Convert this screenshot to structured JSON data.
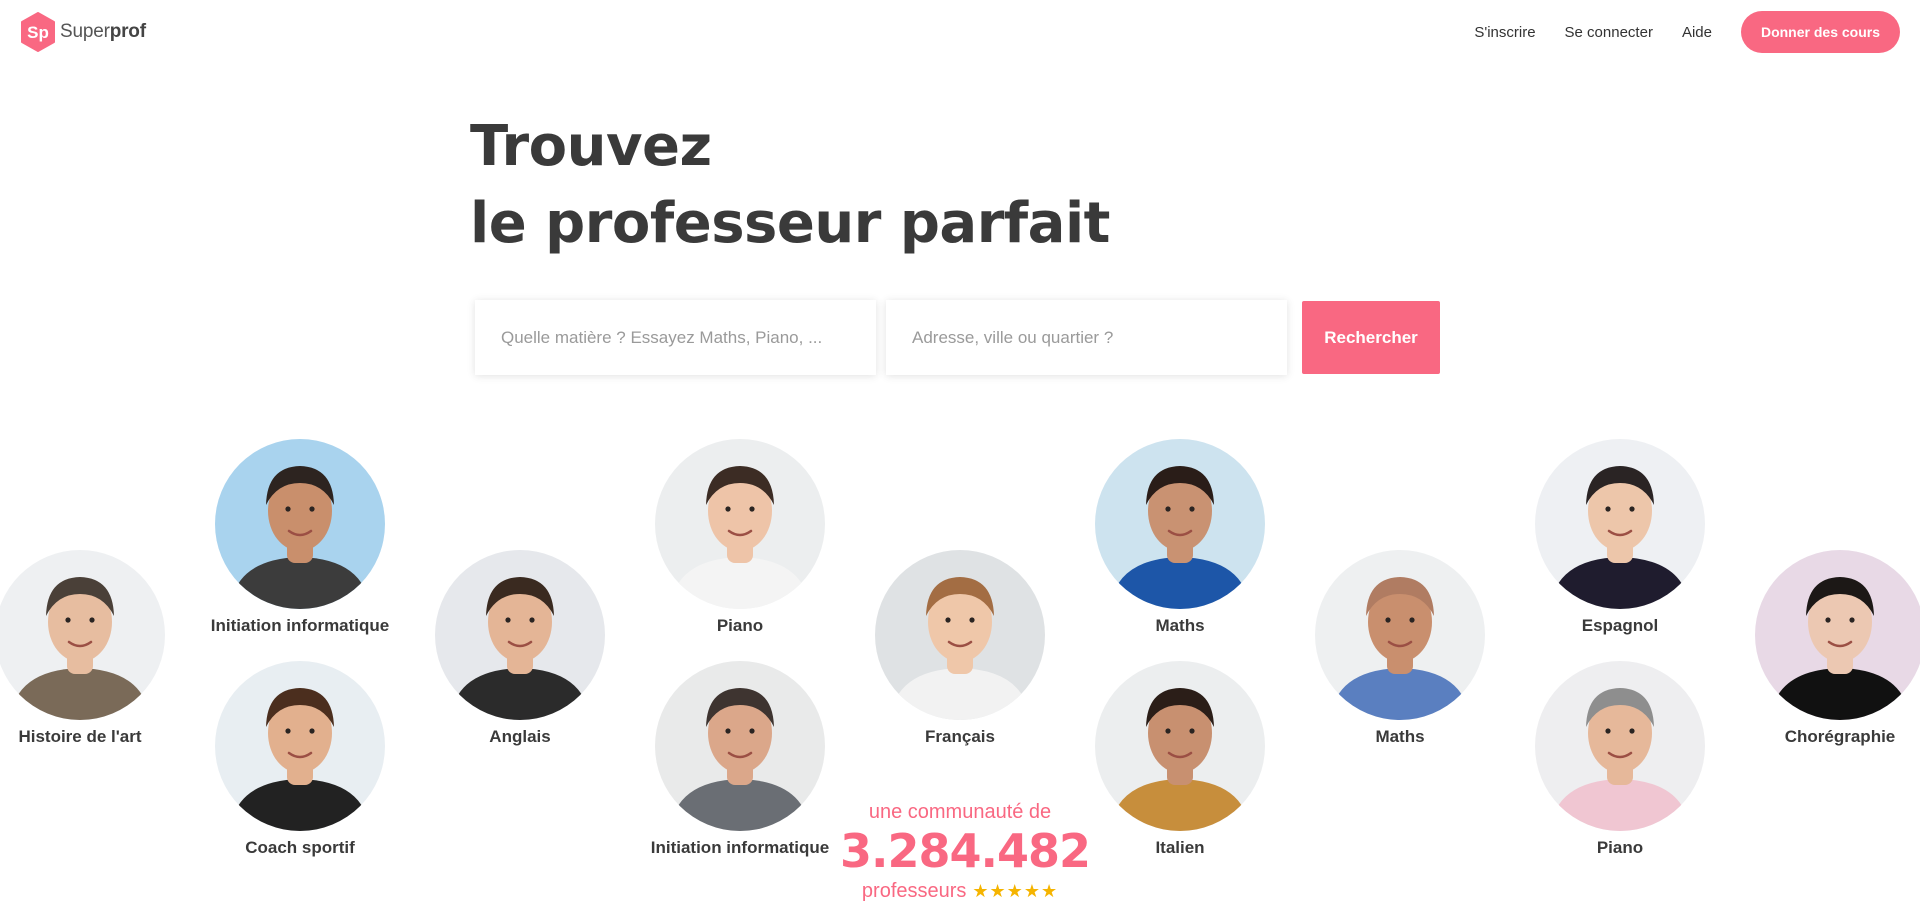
{
  "brand": {
    "logo_mark": "Sp",
    "name_light": "Super",
    "name_bold": "prof",
    "accent": "#f96882"
  },
  "nav": {
    "signup": "S'inscrire",
    "login": "Se connecter",
    "help": "Aide",
    "teach": "Donner des cours"
  },
  "hero": {
    "line1": "Trouvez",
    "line2": "le professeur parfait"
  },
  "search": {
    "subject_placeholder": "Quelle matière ? Essayez Maths, Piano, ...",
    "address_placeholder": "Adresse, ville ou quartier ?",
    "button": "Rechercher"
  },
  "tutors": [
    {
      "subject": "Histoire de l'art",
      "skin": "#e7bda0",
      "hair": "#4a4038",
      "shirt": "#7a6a58",
      "bg": "#eef0f2"
    },
    {
      "subject": "Initiation informatique",
      "skin": "#c98f6c",
      "hair": "#2d2420",
      "shirt": "#3c3c3c",
      "bg": "#a9d3ee"
    },
    {
      "subject": "Coach sportif",
      "skin": "#e2b08e",
      "hair": "#4b2e1e",
      "shirt": "#222222",
      "bg": "#e8eef2"
    },
    {
      "subject": "Anglais",
      "skin": "#e4b596",
      "hair": "#3a2a20",
      "shirt": "#2b2b2b",
      "bg": "#e6e8ec"
    },
    {
      "subject": "Piano",
      "skin": "#eec4a8",
      "hair": "#3c2c24",
      "shirt": "#f4f4f4",
      "bg": "#eceeef"
    },
    {
      "subject": "Initiation informatique",
      "skin": "#dba78a",
      "hair": "#3e3430",
      "shirt": "#6a6e74",
      "bg": "#e9eaea"
    },
    {
      "subject": "Français",
      "skin": "#efc7a9",
      "hair": "#a36d43",
      "shirt": "#f2f2f2",
      "bg": "#dfe2e4"
    },
    {
      "subject": "Maths",
      "skin": "#c99272",
      "hair": "#2a1d18",
      "shirt": "#1d56a8",
      "bg": "#cde3ef"
    },
    {
      "subject": "Italien",
      "skin": "#c89070",
      "hair": "#2b1e18",
      "shirt": "#c78e3c",
      "bg": "#eceeef"
    },
    {
      "subject": "Maths",
      "skin": "#c98f6e",
      "hair": "#b07c62",
      "shirt": "#5a7fc0",
      "bg": "#eef0f1"
    },
    {
      "subject": "Espagnol",
      "skin": "#edc6aa",
      "hair": "#2a2424",
      "shirt": "#1f1c2e",
      "bg": "#eef0f3"
    },
    {
      "subject": "Piano",
      "skin": "#e6b89a",
      "hair": "#8e8e8e",
      "shirt": "#f0c6d2",
      "bg": "#eeeef0"
    },
    {
      "subject": "Chorégraphie",
      "skin": "#ecc8b2",
      "hair": "#1c1816",
      "shirt": "#111111",
      "bg": "#e8d9e6"
    }
  ],
  "community": {
    "line1": "une communauté de",
    "count": "3.284.482",
    "line3": "professeurs",
    "stars": "★★★★★"
  }
}
